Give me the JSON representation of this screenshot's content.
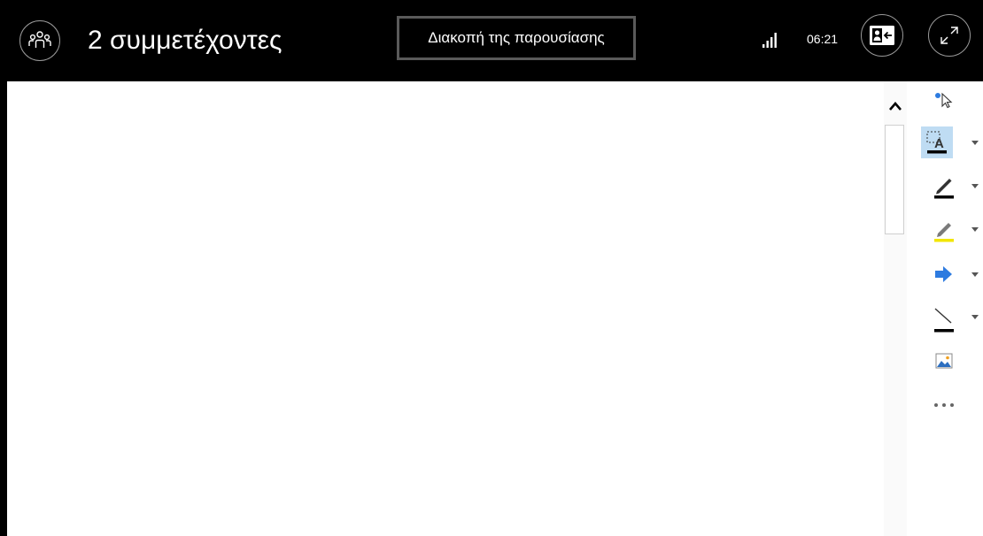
{
  "header": {
    "participants_label": "2 συμμετέχοντες",
    "stop_presentation_label": "Διακοπή της παρουσίασης",
    "time": "06:21"
  },
  "toolbar": {
    "tools": [
      "select",
      "text",
      "pen",
      "highlighter",
      "arrow",
      "line",
      "image",
      "more"
    ],
    "pen_color": "#000000",
    "highlighter_color": "#f2e600",
    "arrow_color": "#2d7be0",
    "selected_tool": "text"
  },
  "colors": {
    "topbar_bg": "#000000",
    "canvas_bg": "#ffffff",
    "selected_tool_bg": "#bfdcf3",
    "accent_blue": "#2d7be0"
  }
}
